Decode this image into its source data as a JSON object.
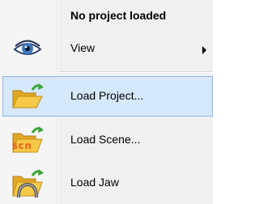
{
  "menu": {
    "header": "No project loaded",
    "items": [
      {
        "label": "View",
        "icon": "eye-icon",
        "submenu": true
      },
      {
        "label": "Load Project...",
        "icon": "folder-open-icon",
        "highlighted": true
      },
      {
        "label": "Load Scene...",
        "icon": "folder-scene-icon",
        "badge": "scn"
      },
      {
        "label": "Load Jaw",
        "icon": "folder-jaw-icon"
      }
    ]
  },
  "colors": {
    "menu_background": "#f0f0f0",
    "highlight_fill": "#d6e8fb",
    "highlight_border": "#8fb6e6",
    "folder_yellow": "#f7c948",
    "arrow_green": "#3aa63a",
    "scn_text": "#e8601c"
  }
}
